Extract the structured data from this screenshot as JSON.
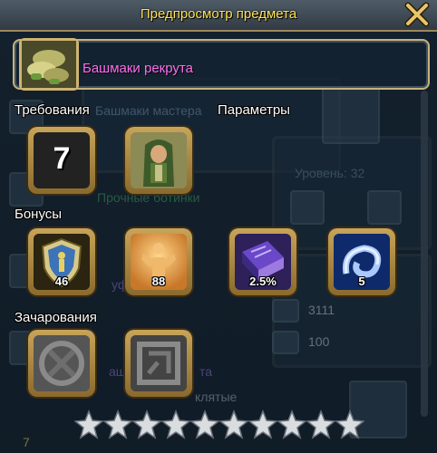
{
  "window": {
    "title": "Предпросмотр предмета"
  },
  "item": {
    "name": "Башмаки рекрута",
    "name_color": "#ff6ef0"
  },
  "background": {
    "item_name": "Башмаки мастера",
    "level_label": "Уровень: 32",
    "item2_name": "Прочные ботинки",
    "partial_text": "уф",
    "stat1": "3111",
    "stat2": "100",
    "item3_name": "аш",
    "item3_suffix": "та",
    "cursed": "клятые",
    "bottom_num": "7"
  },
  "sections": {
    "requirements": "Требования",
    "parameters": "Параметры",
    "bonuses": "Бонусы",
    "enchantments": "Зачарования"
  },
  "requirements": {
    "level": "7"
  },
  "bonuses": [
    {
      "icon": "shield-icon",
      "value": "46"
    },
    {
      "icon": "strength-icon",
      "value": "88"
    },
    {
      "icon": "spellbook-icon",
      "value": "2.5%"
    },
    {
      "icon": "swirl-icon",
      "value": "5"
    }
  ],
  "enchantments": [
    {
      "icon": "empty-rune-icon"
    },
    {
      "icon": "locked-rune-icon"
    }
  ],
  "stars": {
    "total": 10,
    "filled": 0
  },
  "colors": {
    "title": "#ffe55a",
    "frame_gold": "#c7a459"
  }
}
